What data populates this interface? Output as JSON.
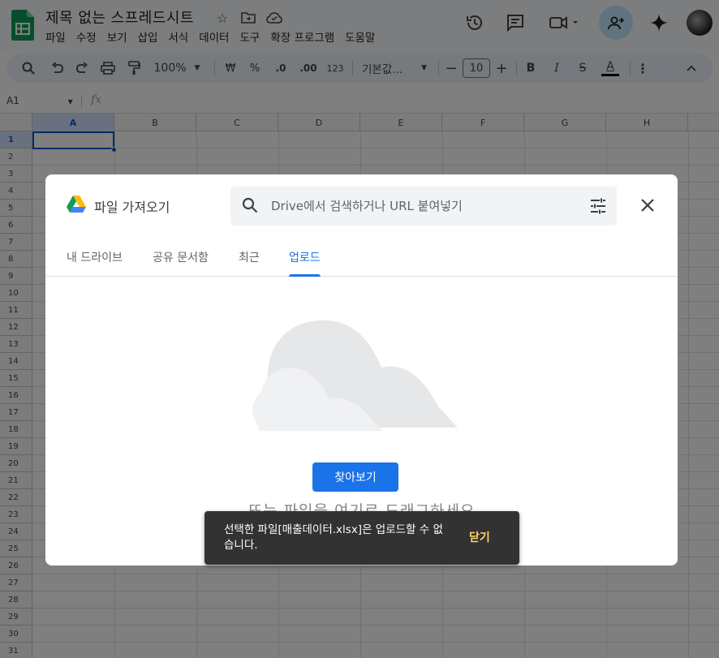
{
  "app": {
    "title": "제목 없는 스프레드시트",
    "menu": [
      "파일",
      "수정",
      "보기",
      "삽입",
      "서식",
      "데이터",
      "도구",
      "확장 프로그램",
      "도움말"
    ]
  },
  "toolbar": {
    "zoom": "100%",
    "currency": "₩",
    "percent": "%",
    "dec_decrease": ".0",
    "dec_increase": ".00",
    "number_format": "123",
    "font": "기본값...",
    "font_size": "10",
    "bold": "B",
    "italic": "I",
    "strike": "S",
    "text_color": "A"
  },
  "formula_bar": {
    "name_box": "A1",
    "fx": "fx"
  },
  "sheet": {
    "columns": [
      "A",
      "B",
      "C",
      "D",
      "E",
      "F",
      "G",
      "H"
    ],
    "rows": [
      "1",
      "2",
      "3",
      "4",
      "5",
      "6",
      "7",
      "8",
      "9",
      "10",
      "11",
      "12",
      "13",
      "14",
      "15",
      "16",
      "17",
      "18",
      "19",
      "20",
      "21",
      "22",
      "23",
      "24",
      "25",
      "26",
      "27",
      "28",
      "29",
      "30",
      "31"
    ],
    "selected_cell": "A1"
  },
  "dialog": {
    "title": "파일 가져오기",
    "search_placeholder": "Drive에서 검색하거나 URL 붙여넣기",
    "tabs": [
      {
        "label": "내 드라이브",
        "active": false
      },
      {
        "label": "공유 문서함",
        "active": false
      },
      {
        "label": "최근",
        "active": false
      },
      {
        "label": "업로드",
        "active": true
      }
    ],
    "browse_button": "찾아보기",
    "drag_text": "또는 파일을 여기로 드래그하세요"
  },
  "snackbar": {
    "message": "선택한 파일[매출데이터.xlsx]은 업로드할 수 없습니다.",
    "action": "닫기"
  },
  "colors": {
    "accent": "#1a73e8",
    "snackbar_bg": "#323232",
    "snackbar_action": "#fdd663",
    "selection": "#0b57d0"
  }
}
